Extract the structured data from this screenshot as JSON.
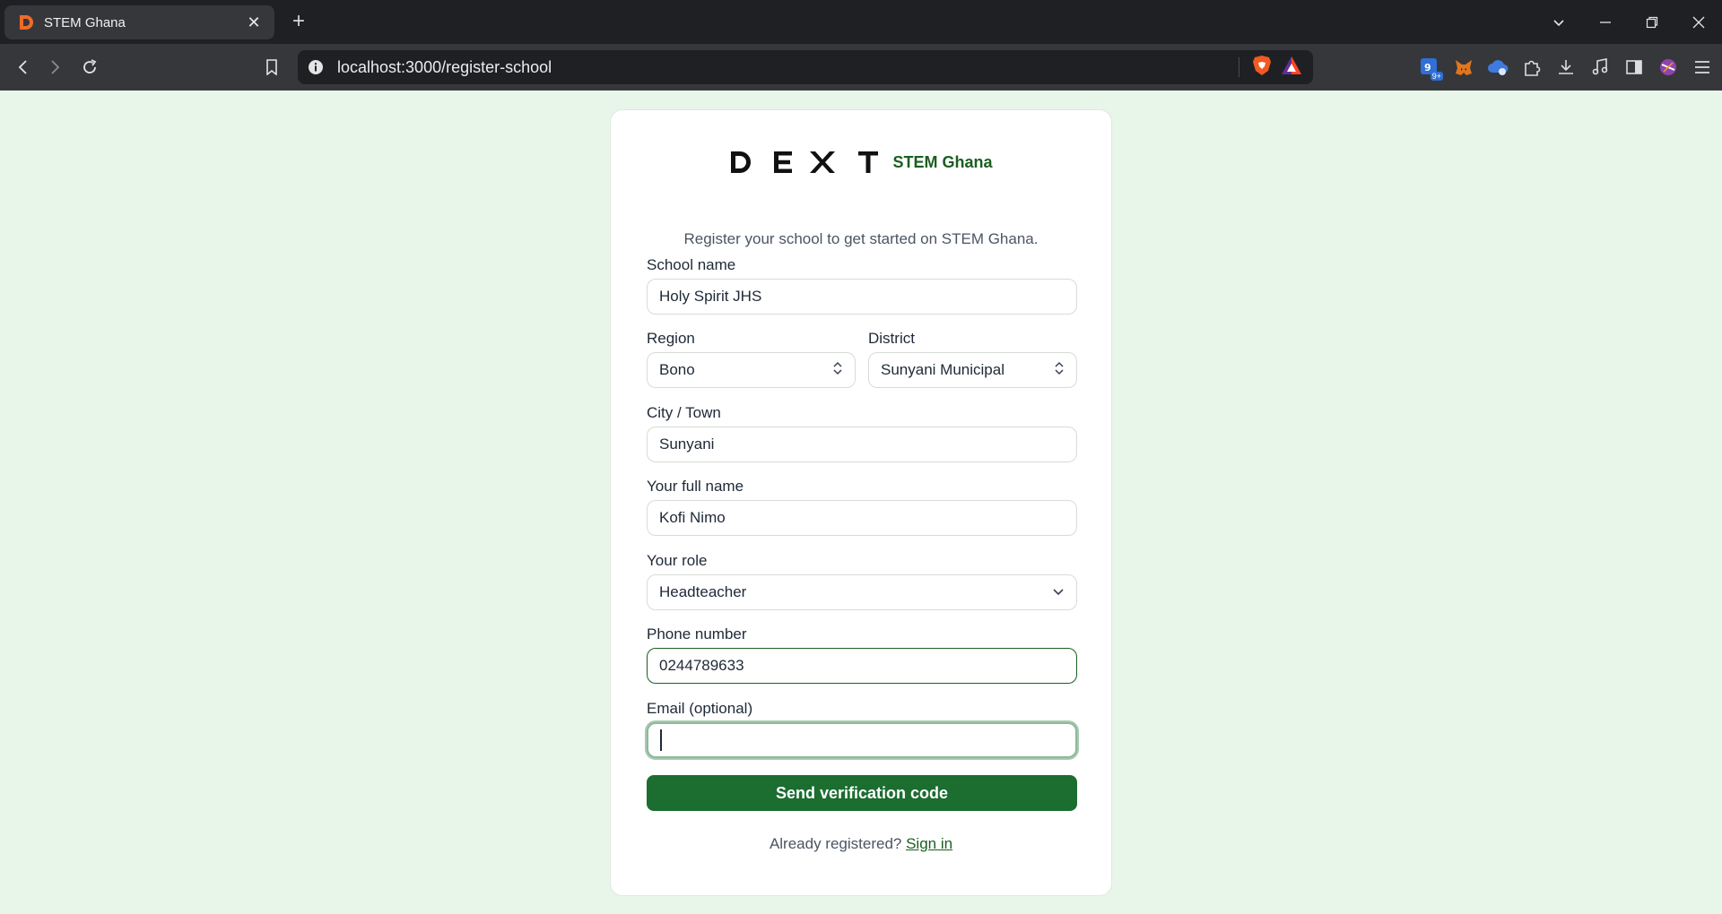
{
  "browser": {
    "tab_title": "STEM Ghana",
    "url": "localhost:3000/register-school",
    "ext_badge": "9+"
  },
  "brand": {
    "logo_text": "DEXT",
    "subtitle": "STEM Ghana"
  },
  "intro": "Register your school to get started on STEM Ghana.",
  "form": {
    "school_name": {
      "label": "School name",
      "value": "Holy Spirit JHS"
    },
    "region": {
      "label": "Region",
      "value": "Bono"
    },
    "district": {
      "label": "District",
      "value": "Sunyani Municipal"
    },
    "city": {
      "label": "City / Town",
      "value": "Sunyani"
    },
    "full_name": {
      "label": "Your full name",
      "value": "Kofi Nimo"
    },
    "role": {
      "label": "Your role",
      "value": "Headteacher"
    },
    "phone": {
      "label": "Phone number",
      "value": "0244789633"
    },
    "email": {
      "label": "Email (optional)",
      "value": ""
    },
    "submit_label": "Send verification code"
  },
  "footer": {
    "text": "Already registered? ",
    "link": "Sign in"
  },
  "colors": {
    "page_bg": "#e8f5e9",
    "brand_green": "#1b5e20",
    "button_green": "#1b6d30"
  }
}
